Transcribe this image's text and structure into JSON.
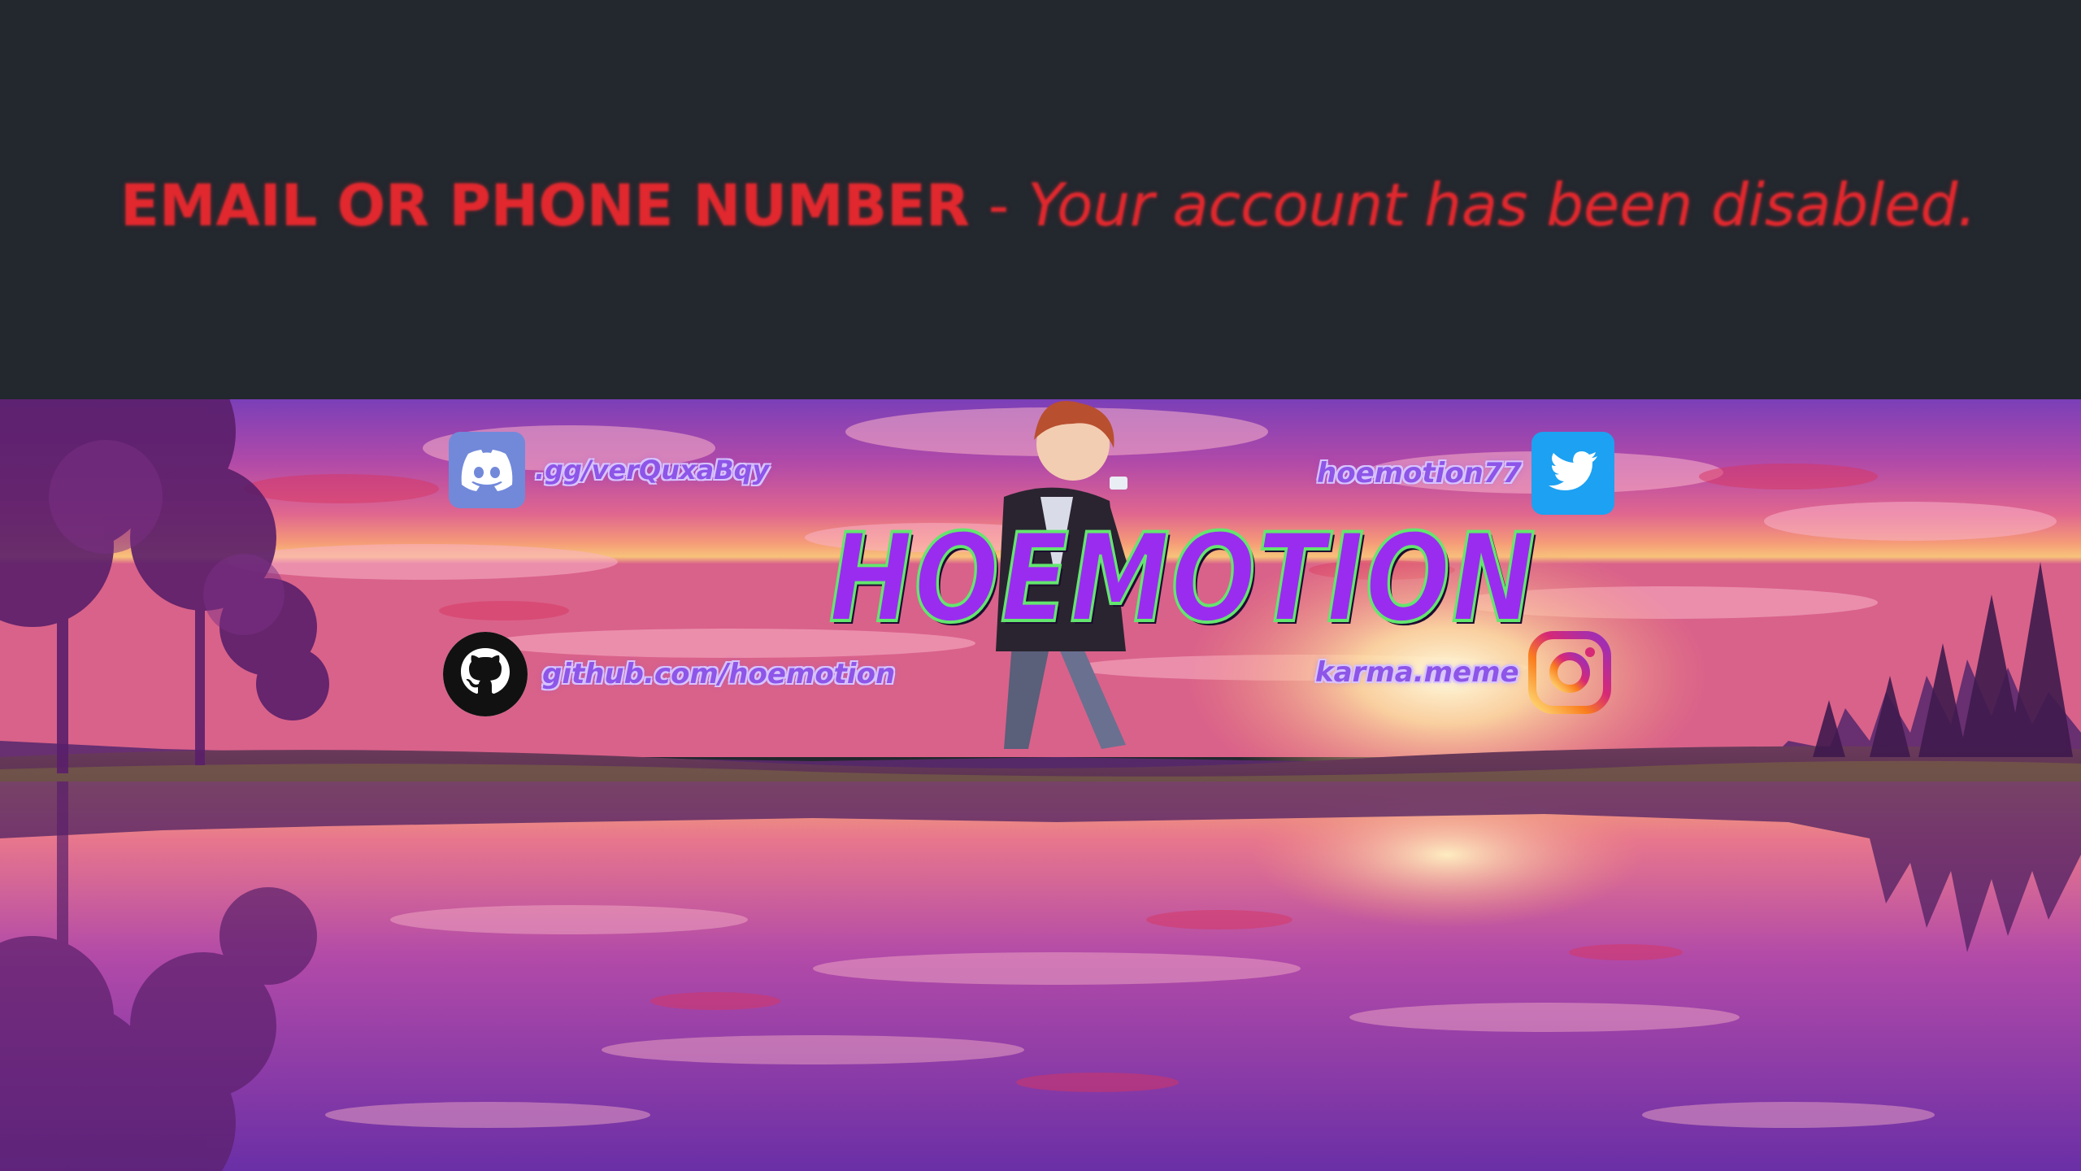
{
  "error": {
    "field": "EMAIL OR PHONE NUMBER",
    "separator": "-",
    "message": "Your account has been disabled."
  },
  "banner": {
    "brand": "HOEMOTION",
    "socials": {
      "discord": {
        "label": ".gg/verQuxaBqy",
        "icon": "discord-icon"
      },
      "github": {
        "label": "github.com/hoemotion",
        "icon": "github-icon"
      },
      "twitter": {
        "label": "hoemotion77",
        "icon": "twitter-icon"
      },
      "instagram": {
        "label": "karma.meme",
        "icon": "instagram-icon"
      }
    }
  },
  "colors": {
    "background_dark": "#23272e",
    "error_red": "#e0282e",
    "label_purple": "#8d55e8",
    "brand_fill": "#9a2cf0",
    "brand_outline": "#63e66e",
    "discord_blurple": "#7289da",
    "twitter_blue": "#1da1f2"
  }
}
